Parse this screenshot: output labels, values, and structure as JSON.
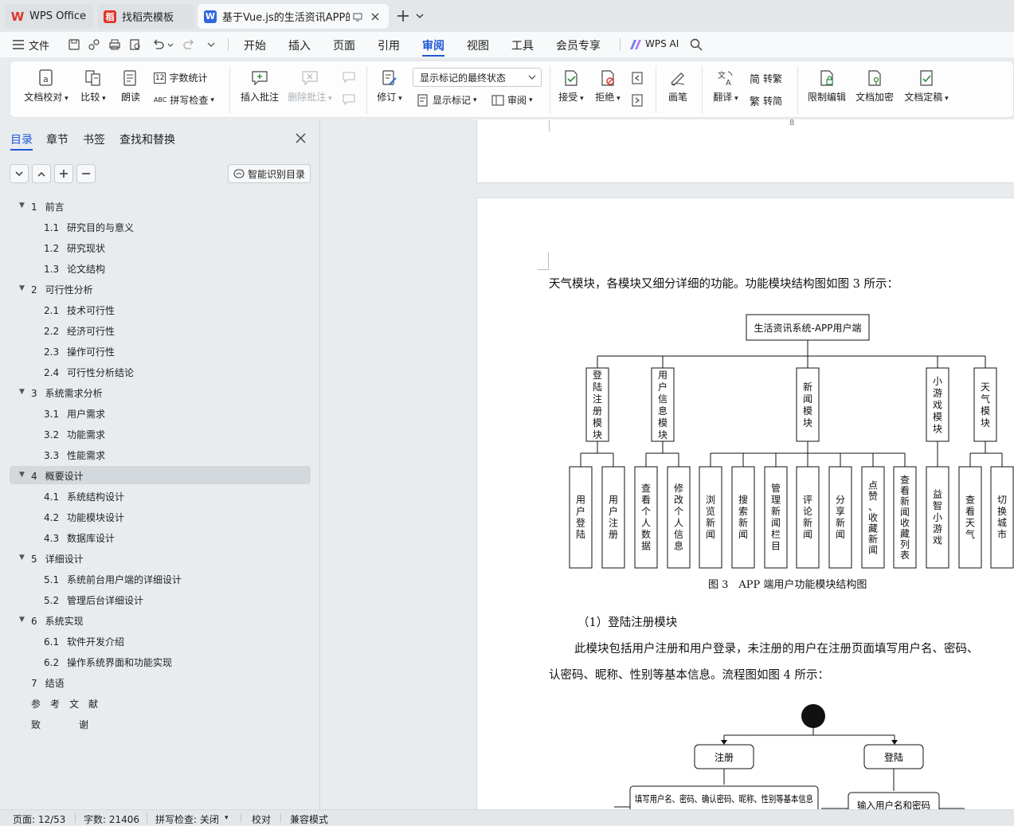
{
  "tabs": [
    {
      "label": "WPS Office",
      "icon": "wps-logo-icon"
    },
    {
      "label": "找稻壳模板",
      "icon": "docer-icon"
    },
    {
      "label": "基于Vue.js的生活资讯APP的论",
      "icon": "word-doc-icon"
    }
  ],
  "menu": {
    "file": "文件",
    "items": [
      "开始",
      "插入",
      "页面",
      "引用",
      "审阅",
      "视图",
      "工具",
      "会员专享"
    ],
    "active": "审阅",
    "wps_ai": "WPS AI"
  },
  "ribbon": {
    "doc_check": "文档校对",
    "compare": "比较",
    "read_aloud": "朗读",
    "word_count": "字数统计",
    "spell_check": "拼写检查",
    "insert_comment": "插入批注",
    "delete_comment": "删除批注",
    "track_changes": "修订",
    "markup_select": "显示标记的最终状态",
    "show_markup": "显示标记",
    "review": "审阅",
    "accept": "接受",
    "reject": "拒绝",
    "pen": "画笔",
    "translate": "翻译",
    "to_traditional": "转繁",
    "to_simplified": "转简",
    "trad_glyph": "简",
    "simp_glyph": "繁",
    "restrict_edit": "限制编辑",
    "doc_encrypt": "文档加密",
    "doc_finalize": "文档定稿",
    "word_count_badge": "12",
    "spell_badge": "ABC"
  },
  "nav": {
    "tabs": [
      "目录",
      "章节",
      "书签",
      "查找和替换"
    ],
    "smart_toc": "智能识别目录",
    "toc": [
      {
        "num": "1",
        "title": "前言",
        "level": 1
      },
      {
        "num": "1.1",
        "title": "研究目的与意义",
        "level": 2
      },
      {
        "num": "1.2",
        "title": "研究现状",
        "level": 2
      },
      {
        "num": "1.3",
        "title": "论文结构",
        "level": 2
      },
      {
        "num": "2",
        "title": "可行性分析",
        "level": 1
      },
      {
        "num": "2.1",
        "title": "技术可行性",
        "level": 2
      },
      {
        "num": "2.2",
        "title": "经济可行性",
        "level": 2
      },
      {
        "num": "2.3",
        "title": "操作可行性",
        "level": 2
      },
      {
        "num": "2.4",
        "title": "可行性分析结论",
        "level": 2
      },
      {
        "num": "3",
        "title": "系统需求分析",
        "level": 1
      },
      {
        "num": "3.1",
        "title": "用户需求",
        "level": 2
      },
      {
        "num": "3.2",
        "title": "功能需求",
        "level": 2
      },
      {
        "num": "3.3",
        "title": "性能需求",
        "level": 2
      },
      {
        "num": "4",
        "title": "概要设计",
        "level": 1
      },
      {
        "num": "4.1",
        "title": "系统结构设计",
        "level": 2
      },
      {
        "num": "4.2",
        "title": "功能模块设计",
        "level": 2
      },
      {
        "num": "4.3",
        "title": "数据库设计",
        "level": 2
      },
      {
        "num": "5",
        "title": "详细设计",
        "level": 1
      },
      {
        "num": "5.1",
        "title": "系统前台用户端的详细设计",
        "level": 2
      },
      {
        "num": "5.2",
        "title": "管理后台详细设计",
        "level": 2
      },
      {
        "num": "6",
        "title": "系统实现",
        "level": 1
      },
      {
        "num": "6.1",
        "title": "软件开发介绍",
        "level": 2
      },
      {
        "num": "6.2",
        "title": "操作系统界面和功能实现",
        "level": 2
      },
      {
        "num": "7",
        "title": "结语",
        "level": 0
      },
      {
        "num": "",
        "title": "参　考　文　献",
        "level": 0
      },
      {
        "num": "",
        "title": "致　　　　谢",
        "level": 0
      }
    ]
  },
  "document": {
    "prev_page_number": "8",
    "intro_line": "天气模块，各模块又细分详细的功能。功能模块结构图如图 3 所示：",
    "fig3": {
      "root": "生活资讯系统-APP用户端",
      "modules": [
        {
          "name": "登陆注册模块",
          "children": [
            "用户登陆",
            "用户注册"
          ]
        },
        {
          "name": "用户信息模块",
          "children": [
            "查看个人数据",
            "修改个人信息"
          ]
        },
        {
          "name": "新闻模块",
          "children": [
            "浏览新闻",
            "搜索新闻",
            "管理新闻栏目",
            "评论新闻",
            "分享新闻",
            "点赞、收藏新闻",
            "查看新闻收藏列表"
          ]
        },
        {
          "name": "小游戏模块",
          "children": [
            "益智小游戏"
          ]
        },
        {
          "name": "天气模块",
          "children": [
            "查看天气",
            "切换城市"
          ]
        }
      ],
      "caption": "图 3　APP 端用户功能模块结构图"
    },
    "section_heading": "（1）登陆注册模块",
    "para_line1": "此模块包括用户注册和用户登录，未注册的用户在注册页面填写用户名、密码、",
    "para_line2": "认密码、昵称、性别等基本信息。流程图如图 4 所示：",
    "fig4": {
      "register": "注册",
      "login": "登陆",
      "fill_info": "填写用户名、密码、确认密码、昵称、性别等基本信息",
      "input_credentials": "输入用户名和密码"
    }
  },
  "status": {
    "page": "页面: 12/53",
    "words": "字数: 21406",
    "spell": "拼写检查: 关闭",
    "proof": "校对",
    "compat": "兼容模式"
  },
  "colors": {
    "accent": "#1f57d6",
    "wps_red": "#e0352b"
  }
}
